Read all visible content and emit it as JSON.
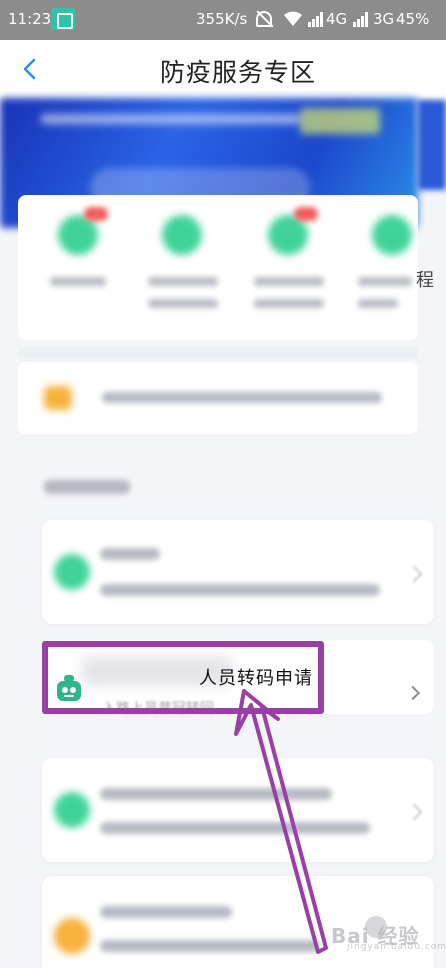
{
  "status_bar": {
    "time": "11:23",
    "speed": "355K/s",
    "network_1": "4G",
    "network_2": "3G",
    "battery": "45%"
  },
  "header": {
    "title": "防疫服务专区",
    "back_icon": "chevron-left-icon"
  },
  "quick_access": {
    "edge_text": "程"
  },
  "service_item": {
    "title": "人员转码申请",
    "subtitle": "入路上员昔冠转回"
  },
  "watermark": {
    "text": "Bai 经验",
    "sub": "jingyan.baidu.com"
  },
  "colors": {
    "accent": "#3fd39a",
    "annotation": "#9a3fa6",
    "back_icon": "#2f8fe6",
    "status_bar": "#8c8c8c"
  }
}
